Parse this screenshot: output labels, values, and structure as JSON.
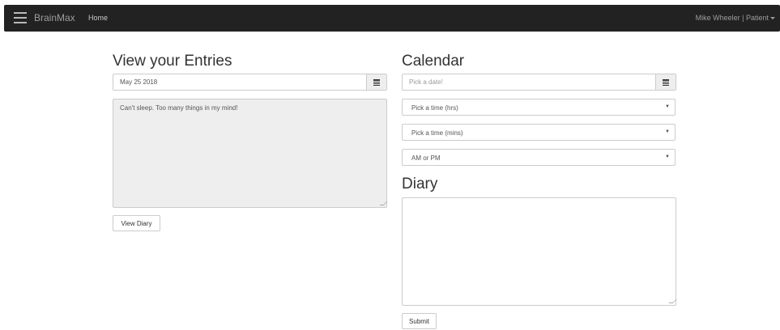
{
  "navbar": {
    "brand": "BrainMax",
    "home": "Home",
    "user": "Mike Wheeler | Patient"
  },
  "entries": {
    "title": "View your Entries",
    "date_value": "May 25 2018",
    "entry_text": "Can't sleep. Too many things in my mind!",
    "view_button": "View Diary"
  },
  "calendar": {
    "title": "Calendar",
    "date_placeholder": "Pick a date!",
    "hour_select": "Pick a time (hrs)",
    "minute_select": "Pick a time (mins)",
    "ampm_select": "AM or PM"
  },
  "diary": {
    "title": "Diary",
    "text": "",
    "submit_button": "Submit"
  },
  "icons": {
    "menu": "hamburger-menu-icon",
    "calendar": "calendar-icon",
    "dropdown": "dropdown-arrow-icon"
  },
  "colors": {
    "navbar_bg": "#222222",
    "readonly_bg": "#eeeeee",
    "border": "#cccccc"
  }
}
